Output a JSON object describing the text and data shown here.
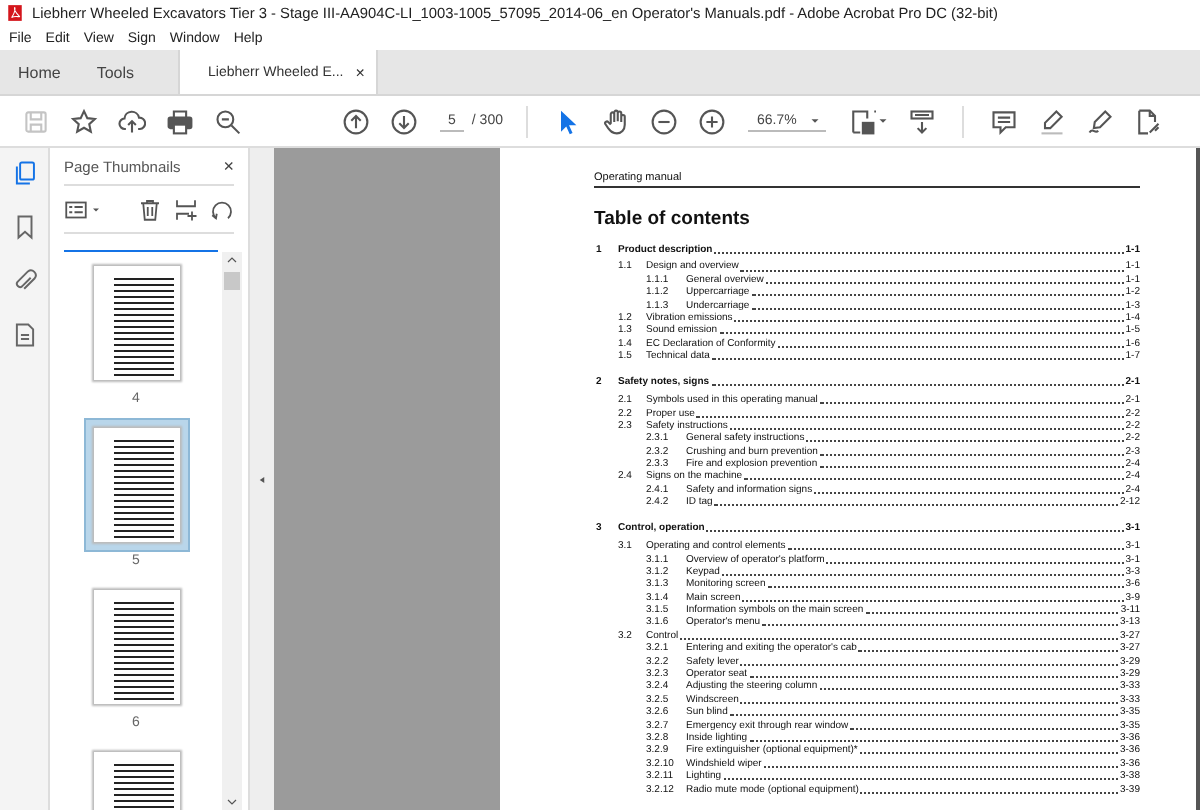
{
  "window": {
    "title": "Liebherr Wheeled Excavators Tier 3 - Stage III-AA904C-LI_1003-1005_57095_2014-06_en Operator's Manuals.pdf - Adobe Acrobat Pro DC (32-bit)"
  },
  "menu": [
    "File",
    "Edit",
    "View",
    "Sign",
    "Window",
    "Help"
  ],
  "tabs": [
    {
      "label": "Home",
      "selected": false,
      "kind": "nav"
    },
    {
      "label": "Tools",
      "selected": false,
      "kind": "nav"
    },
    {
      "label": "Liebherr Wheeled E...",
      "selected": true,
      "kind": "document",
      "close": "×"
    }
  ],
  "toolbar": {
    "save_disabled": true,
    "page_number": "5",
    "page_count": "/ 300",
    "tools": [
      {
        "kind": "select",
        "selected": true
      },
      {
        "kind": "hand",
        "selected": false
      }
    ],
    "zoom": "66.7%"
  },
  "side_rail": [
    {
      "kind": "pages",
      "selected": true
    },
    {
      "kind": "bookmarks",
      "selected": false
    },
    {
      "kind": "attachments",
      "selected": false
    },
    {
      "kind": "document",
      "selected": false
    }
  ],
  "thumbnails_panel": {
    "title": "Page Thumbnails",
    "close": "×",
    "thumbnails": [
      {
        "label": "4",
        "selected": false
      },
      {
        "label": "5",
        "selected": true
      },
      {
        "label": "6",
        "selected": false
      },
      {
        "selected": false
      }
    ]
  },
  "document": {
    "header": "Operating manual",
    "heading": "Table of contents",
    "toc": [
      {
        "number": "1",
        "title": "Product description",
        "page": "1-1",
        "children": [
          {
            "number": "1.1",
            "title": "Design and overview",
            "page": "1-1",
            "children": [
              {
                "number": "1.1.1",
                "title": "General overview",
                "page": "1-1"
              },
              {
                "number": "1.1.2",
                "title": "Uppercarriage",
                "page": "1-2"
              },
              {
                "number": "1.1.3",
                "title": "Undercarriage",
                "page": "1-3"
              }
            ]
          },
          {
            "number": "1.2",
            "title": "Vibration emissions",
            "page": "1-4"
          },
          {
            "number": "1.3",
            "title": "Sound emission",
            "page": "1-5"
          },
          {
            "number": "1.4",
            "title": "EC Declaration of Conformity",
            "page": "1-6"
          },
          {
            "number": "1.5",
            "title": "Technical data",
            "page": "1-7"
          }
        ]
      },
      {
        "number": "2",
        "title": "Safety notes, signs",
        "page": "2-1",
        "children": [
          {
            "number": "2.1",
            "title": "Symbols used in this operating manual",
            "page": "2-1"
          },
          {
            "number": "2.2",
            "title": "Proper use",
            "page": "2-2"
          },
          {
            "number": "2.3",
            "title": "Safety instructions",
            "page": "2-2",
            "children": [
              {
                "number": "2.3.1",
                "title": "General safety instructions",
                "page": "2-2"
              },
              {
                "number": "2.3.2",
                "title": "Crushing and burn prevention",
                "page": "2-3"
              },
              {
                "number": "2.3.3",
                "title": "Fire and explosion prevention",
                "page": "2-4"
              }
            ]
          },
          {
            "number": "2.4",
            "title": "Signs on the machine",
            "page": "2-4",
            "children": [
              {
                "number": "2.4.1",
                "title": "Safety and information signs",
                "page": "2-4"
              },
              {
                "number": "2.4.2",
                "title": "ID tag",
                "page": "2-12"
              }
            ]
          }
        ]
      },
      {
        "number": "3",
        "title": "Control, operation",
        "page": "3-1",
        "children": [
          {
            "number": "3.1",
            "title": "Operating and control elements",
            "page": "3-1",
            "children": [
              {
                "number": "3.1.1",
                "title": "Overview of operator's platform",
                "page": "3-1"
              },
              {
                "number": "3.1.2",
                "title": "Keypad",
                "page": "3-3"
              },
              {
                "number": "3.1.3",
                "title": "Monitoring screen",
                "page": "3-6"
              },
              {
                "number": "3.1.4",
                "title": "Main screen",
                "page": "3-9"
              },
              {
                "number": "3.1.5",
                "title": "Information symbols on the main screen",
                "page": "3-11"
              },
              {
                "number": "3.1.6",
                "title": "Operator's menu",
                "page": "3-13"
              }
            ]
          },
          {
            "number": "3.2",
            "title": "Control",
            "page": "3-27",
            "children": [
              {
                "number": "3.2.1",
                "title": "Entering and exiting the operator's cab",
                "page": "3-27"
              },
              {
                "number": "3.2.2",
                "title": "Safety lever",
                "page": "3-29"
              },
              {
                "number": "3.2.3",
                "title": "Operator seat",
                "page": "3-29"
              },
              {
                "number": "3.2.4",
                "title": "Adjusting the steering column",
                "page": "3-33"
              },
              {
                "number": "3.2.5",
                "title": "Windscreen",
                "page": "3-33"
              },
              {
                "number": "3.2.6",
                "title": "Sun blind",
                "page": "3-35"
              },
              {
                "number": "3.2.7",
                "title": "Emergency exit through rear window",
                "page": "3-35"
              },
              {
                "number": "3.2.8",
                "title": "Inside lighting",
                "page": "3-36"
              },
              {
                "number": "3.2.9",
                "title": "Fire extinguisher (optional equipment)*",
                "page": "3-36"
              },
              {
                "number": "3.2.10",
                "title": "Windshield wiper",
                "page": "3-36"
              },
              {
                "number": "3.2.11",
                "title": "Lighting",
                "page": "3-38"
              },
              {
                "number": "3.2.12",
                "title": "Radio mute mode (optional equipment)",
                "page": "3-39"
              }
            ]
          }
        ]
      }
    ]
  }
}
